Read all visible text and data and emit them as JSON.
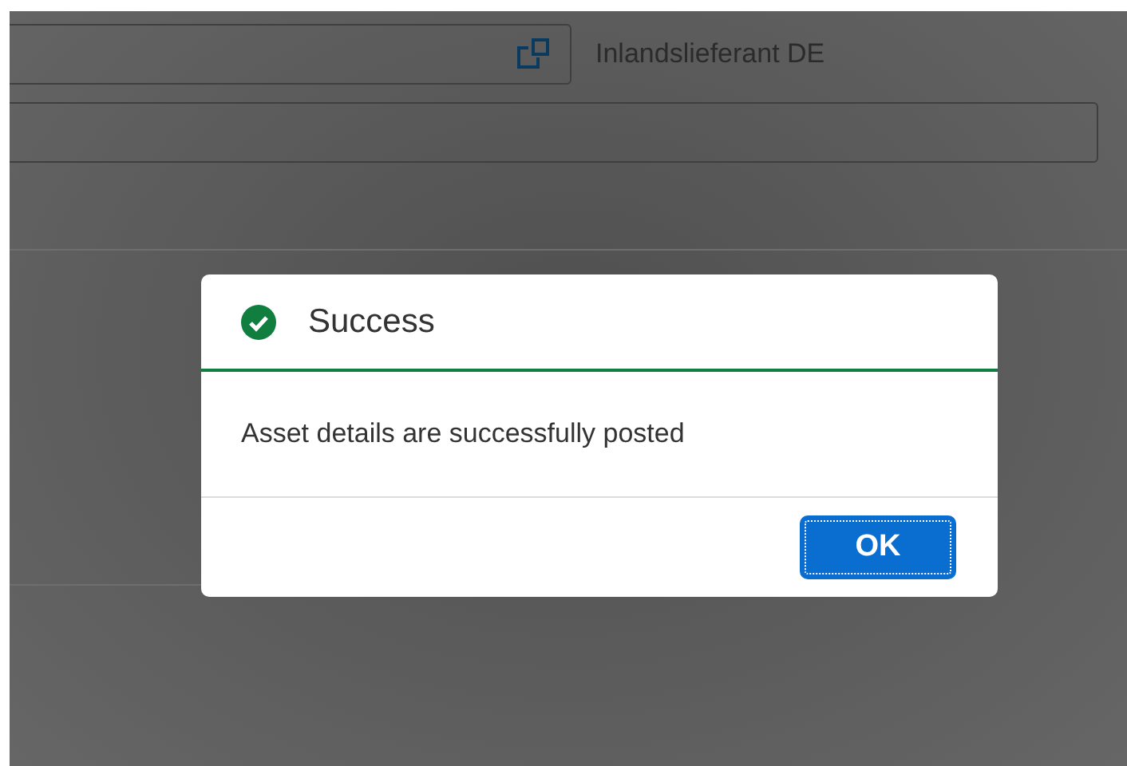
{
  "form": {
    "supplier_name": "Inlandslieferant DE"
  },
  "dialog": {
    "kind": "success",
    "title": "Success",
    "message": "Asset details are successfully posted",
    "buttons": [
      {
        "label": "OK",
        "selected": true
      }
    ]
  }
}
